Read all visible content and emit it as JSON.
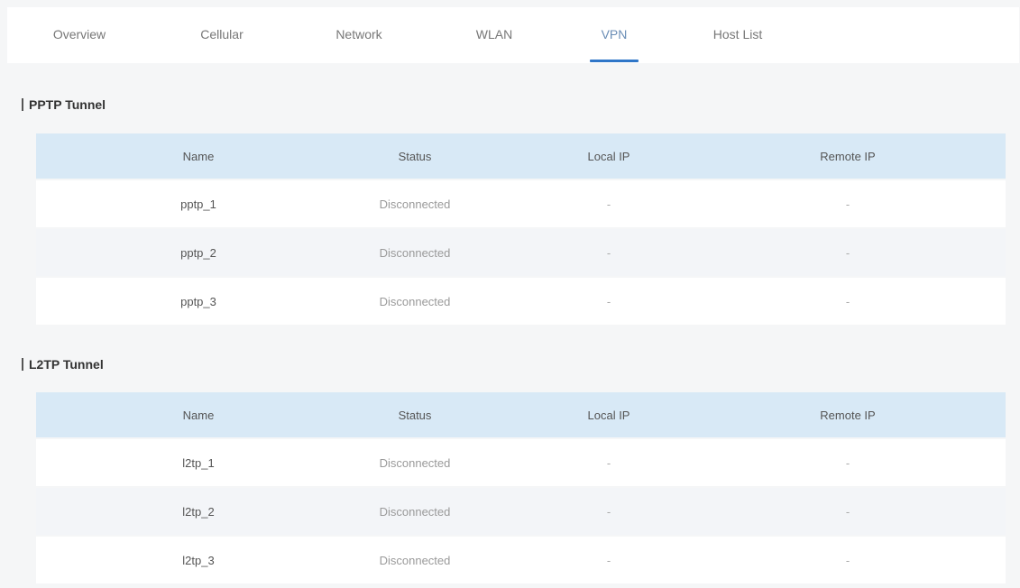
{
  "tabs": [
    {
      "label": "Overview",
      "active": false
    },
    {
      "label": "Cellular",
      "active": false
    },
    {
      "label": "Network",
      "active": false
    },
    {
      "label": "WLAN",
      "active": false
    },
    {
      "label": "VPN",
      "active": true
    },
    {
      "label": "Host List",
      "active": false
    }
  ],
  "colors": {
    "accent": "#2f76c8",
    "header_row": "#d8e9f6",
    "background": "#f5f6f7"
  },
  "pptp": {
    "title": "PPTP Tunnel",
    "columns": [
      "Name",
      "Status",
      "Local IP",
      "Remote IP"
    ],
    "rows": [
      {
        "name": "pptp_1",
        "status": "Disconnected",
        "local_ip": "-",
        "remote_ip": "-"
      },
      {
        "name": "pptp_2",
        "status": "Disconnected",
        "local_ip": "-",
        "remote_ip": "-"
      },
      {
        "name": "pptp_3",
        "status": "Disconnected",
        "local_ip": "-",
        "remote_ip": "-"
      }
    ]
  },
  "l2tp": {
    "title": "L2TP Tunnel",
    "columns": [
      "Name",
      "Status",
      "Local IP",
      "Remote IP"
    ],
    "rows": [
      {
        "name": "l2tp_1",
        "status": "Disconnected",
        "local_ip": "-",
        "remote_ip": "-"
      },
      {
        "name": "l2tp_2",
        "status": "Disconnected",
        "local_ip": "-",
        "remote_ip": "-"
      },
      {
        "name": "l2tp_3",
        "status": "Disconnected",
        "local_ip": "-",
        "remote_ip": "-"
      }
    ]
  }
}
